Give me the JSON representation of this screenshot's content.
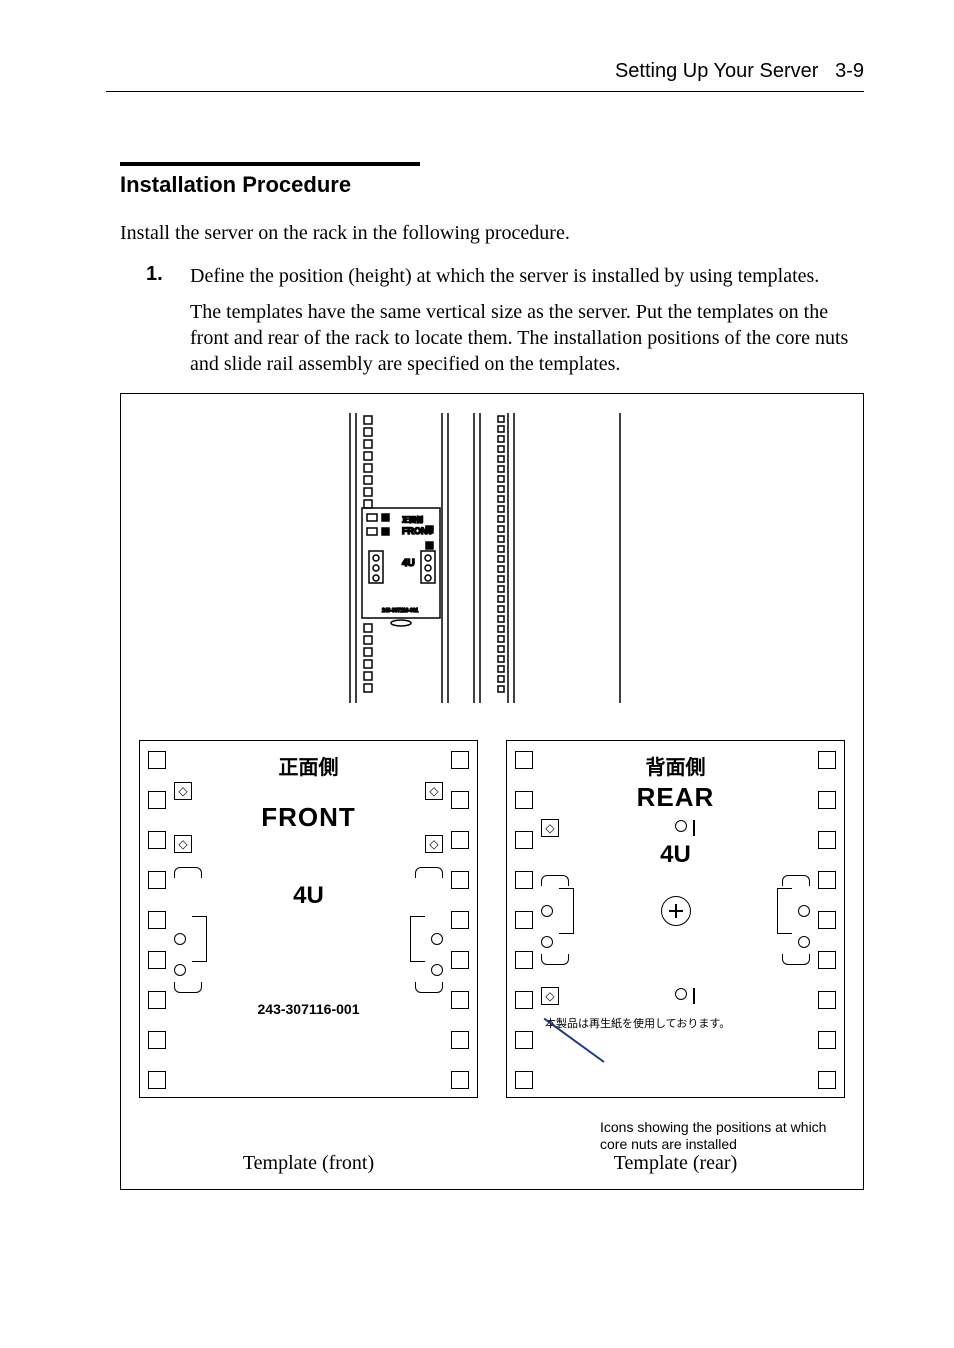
{
  "header": {
    "chapter": "Setting Up Your Server",
    "page": "3-9"
  },
  "section": {
    "title": "Installation Procedure",
    "intro": "Install the server on the rack in the following procedure."
  },
  "step1": {
    "num": "1.",
    "body": "Define the position (height) at which the server is installed by using templates.",
    "detail": "The templates have the same vertical size as the server. Put the templates on the front and rear of the rack to locate them. The installation positions of the core nuts and slide rail assembly are specified on the templates."
  },
  "figure": {
    "rack": {
      "jp_front": "正面側",
      "en_front": "FRONT",
      "u": "4U"
    },
    "template_front": {
      "jp": "正面側",
      "en": "FRONT",
      "u": "4U",
      "partno": "243-307116-001",
      "caption": "Template (front)"
    },
    "template_rear": {
      "jp": "背面側",
      "en": "REAR",
      "u": "4U",
      "recycled_note": "本製品は再生紙を使用しております。",
      "caption": "Template (rear)"
    },
    "callout": "Icons showing the positions at which core nuts are installed"
  }
}
